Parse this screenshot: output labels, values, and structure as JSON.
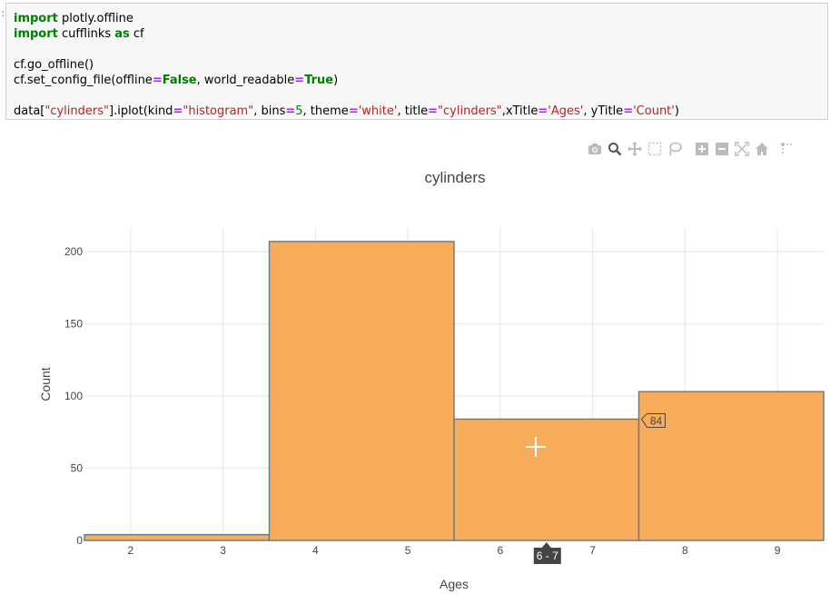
{
  "code_cell": {
    "prompt": ":",
    "lines": [
      [
        {
          "t": "import",
          "c": "kw"
        },
        {
          "t": " plotly.offline",
          "c": ""
        }
      ],
      [
        {
          "t": "import",
          "c": "kw"
        },
        {
          "t": " cufflinks ",
          "c": ""
        },
        {
          "t": "as",
          "c": "kw"
        },
        {
          "t": " cf",
          "c": ""
        }
      ],
      [],
      [
        {
          "t": "cf.go_offline()",
          "c": ""
        }
      ],
      [
        {
          "t": "cf.set_config_file(offline",
          "c": ""
        },
        {
          "t": "=",
          "c": "op"
        },
        {
          "t": "False",
          "c": "kw"
        },
        {
          "t": ", world_readable",
          "c": ""
        },
        {
          "t": "=",
          "c": "op"
        },
        {
          "t": "True",
          "c": "kw"
        },
        {
          "t": ")",
          "c": ""
        }
      ],
      [],
      [
        {
          "t": "data[",
          "c": ""
        },
        {
          "t": "\"cylinders\"",
          "c": "str"
        },
        {
          "t": "].iplot(kind",
          "c": ""
        },
        {
          "t": "=",
          "c": "op"
        },
        {
          "t": "\"histogram\"",
          "c": "str"
        },
        {
          "t": ", bins",
          "c": ""
        },
        {
          "t": "=",
          "c": "op"
        },
        {
          "t": "5",
          "c": "num"
        },
        {
          "t": ", theme",
          "c": ""
        },
        {
          "t": "=",
          "c": "op"
        },
        {
          "t": "'white'",
          "c": "str"
        },
        {
          "t": ", title",
          "c": ""
        },
        {
          "t": "=",
          "c": "op"
        },
        {
          "t": "\"cylinders\"",
          "c": "str"
        },
        {
          "t": ",xTitle",
          "c": ""
        },
        {
          "t": "=",
          "c": "op"
        },
        {
          "t": "'Ages'",
          "c": "str"
        },
        {
          "t": ", yTitle",
          "c": ""
        },
        {
          "t": "=",
          "c": "op"
        },
        {
          "t": "'Count'",
          "c": "str"
        },
        {
          "t": ")",
          "c": ""
        }
      ]
    ]
  },
  "modebar": {
    "icons": [
      "camera-icon",
      "zoom-icon",
      "pan-icon",
      "box-select-icon",
      "lasso-icon",
      "zoom-in-icon",
      "zoom-out-icon",
      "autoscale-icon",
      "home-icon",
      "spike-lines-icon"
    ]
  },
  "colors": {
    "bar_fill": "#f7ad5c",
    "bar_stroke": "#707b88",
    "grid": "#e6e6e6",
    "axis_text": "#444444",
    "tooltip_bg": "#444444"
  },
  "chart_data": {
    "type": "bar",
    "title": "cylinders",
    "xlabel": "Ages",
    "ylabel": "Count",
    "bins": [
      {
        "x0": 1.5,
        "x1": 3.5,
        "count": 4
      },
      {
        "x0": 3.5,
        "x1": 5.5,
        "count": 207
      },
      {
        "x0": 5.5,
        "x1": 7.5,
        "count": 84
      },
      {
        "x0": 7.5,
        "x1": 9.5,
        "count": 103
      }
    ],
    "xlim": [
      1.5,
      9.5
    ],
    "ylim": [
      0,
      217
    ],
    "xticks": [
      2,
      3,
      4,
      5,
      6,
      7,
      8,
      9
    ],
    "yticks": [
      0,
      50,
      100,
      150,
      200
    ],
    "grid": true,
    "hover": {
      "y_label": "84",
      "x_label": "6 - 7"
    }
  }
}
